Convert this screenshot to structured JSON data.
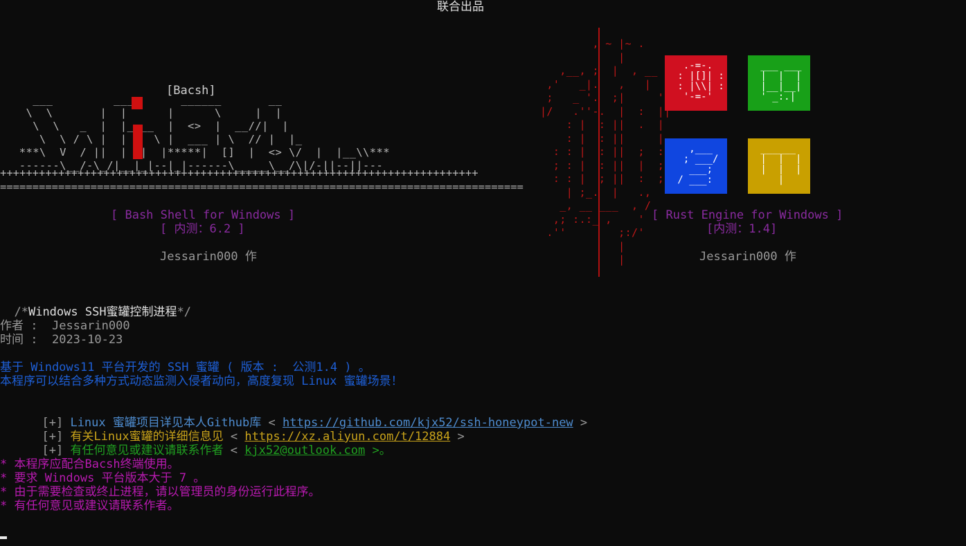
{
  "header": {
    "co_credit": "联合出品"
  },
  "banner_left": {
    "product_tag": "[Bacsh]",
    "ascii_logo": "   ___         ___       ______       __\n  \\  \\       |  |      |      \\     |  |\n   \\  \\   _  |  |____  |  <>  |  __//|  |\n    \\  \\ / \\ |  |    \\ |  ___ | \\  // |  |_\n ***\\  V  / ||  |  |  |*****|  []  |  <> \\/  |  |__\\\\***\n ------\\__/-\\_/|__|_|--|_|------\\_____\\__/\\|/-||--||---",
    "plus_rule": "++++++++++++++++++++++++++++++++++++++++++++++++++++++++++++++++++++++++++",
    "equals_rule": "=================================================================================",
    "subtitle": "[ Bash Shell for Windows ]",
    "version": "[ 内测：6.2 ]",
    "author": "Jessarin000 作"
  },
  "banner_right": {
    "ascii_emblem": "        , ~ |~ .\n            |\n   ,__, ;  |  , __\n ,'   _|.   ,   |\n ;   _ '.  ;|     '.\n|/   .''-.  |  :  ||\n    : |  : ||  .  |\n    : |  : ||     |\n  : : |  : ||  ;  :\n  ; : |  : ||  |  ;\n  : : |  ; ||  :  ;\n    | ;_.  |   .,\n   _, __ ___  , /\n  ,; :.:_ ,    '\n .''        ;:/'\n            |\n            |",
    "tiles": [
      {
        "color": "#d01020",
        "art": "  .-=-.\n : |[]| :\n : |\\\\| :\n  '-=-'"
      },
      {
        "color": "#18a018",
        "art": " ___ ___\n |  |  |\n |__|__|\n ' _:.|"
      },
      {
        "color": "#1046e0",
        "art": "   ,___\n  ; ___/\n   ___;\n / ___:"
      },
      {
        "color": "#c9a000",
        "art": " ______\n |  |  |\n |  |  |\n    |"
      }
    ],
    "subtitle": "[ Rust Engine for Windows ]",
    "version": "[内测：1.4]",
    "author": "Jessarin000 作"
  },
  "body": {
    "title_prefix": "/*",
    "title_text": "Windows SSH蜜罐控制进程",
    "title_suffix": "*/",
    "author_label": "作者 :",
    "author_value": "Jessarin000",
    "date_label": "时间 :",
    "date_value": "2023-10-23",
    "desc_line1": "基于 Windows11 平台开发的 SSH 蜜罐 ( 版本 :  公测1.4 ) 。",
    "desc_line2": "本程序可以结合多种方式动态监测入侵者动向，高度复现 Linux 蜜罐场景！",
    "links": [
      {
        "bullet": "[+]",
        "text": "Linux 蜜罐项目详见本人Github库",
        "open": "<",
        "url": "https://github.com/kjx52/ssh-honeypot-new",
        "close": ">",
        "color": "lightblue"
      },
      {
        "bullet": "[+]",
        "text": "有关Linux蜜罐的详细信息见",
        "open": "<",
        "url": "https://xz.aliyun.com/t/12884",
        "close": ">",
        "color": "yellow"
      },
      {
        "bullet": "[+]",
        "text": "有任何意见或建议请联系作者",
        "open": "<",
        "url": "kjx52@outlook.com",
        "close": ">。",
        "color": "green"
      }
    ],
    "notes": [
      "* 本程序应配合Bacsh终端使用。",
      "* 要求 Windows 平台版本大于 7 。",
      "* 由于需要检查或终止进程，请以管理员的身份运行此程序。",
      "* 有任何意见或建议请联系作者。"
    ]
  }
}
